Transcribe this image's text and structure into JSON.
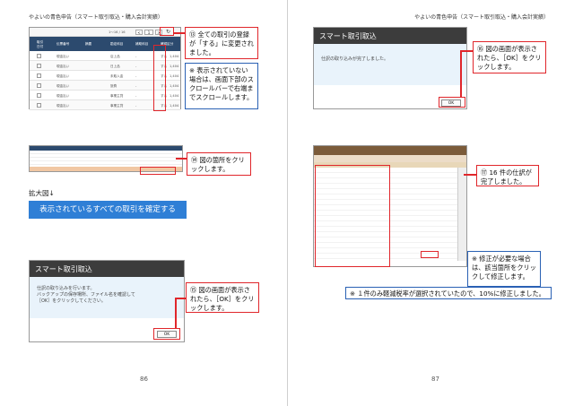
{
  "header": {
    "left": "やよいの青色申告（スマート取引取込・購入会計実績）",
    "right": "やよいの青色申告（スマート取引取込・購入会計実績）"
  },
  "page_numbers": {
    "left": "86",
    "right": "87"
  },
  "top_table": {
    "pager": "1～16 / 16",
    "page_input": "1",
    "headers": [
      "取引\n日付",
      "伝票番号",
      "摘要",
      "勘定科目",
      "補助科目",
      "確認区分"
    ],
    "rows": [
      [
        "現金払い",
        "店上品",
        "-",
        "する"
      ],
      [
        "現金払い",
        "日上品",
        "-",
        "する"
      ],
      [
        "現金払い",
        "未取入金",
        "-",
        "する"
      ],
      [
        "現金払い",
        "旅費",
        "-",
        "する"
      ],
      [
        "現金払い",
        "事業主貸",
        "-",
        "する"
      ],
      [
        "現金払い",
        "事業主貸",
        "-",
        "する"
      ]
    ],
    "amounts": [
      "1,404",
      "1,404",
      "1,404",
      "1,404",
      "1,404",
      "1,404"
    ]
  },
  "callout_13": "⑬ 全ての取引の登録が「する」に変更されました。",
  "callout_note_scroll": "※ 表示されていない場合は、画面下部のスクロールバーで右端までスクロールします。",
  "callout_14": "⑭ 図の箇所をクリックします。",
  "zoom_label": "拡大図↓",
  "confirm_button": "表示されているすべての取引を確定する",
  "dialog1": {
    "title": "スマート取引取込",
    "body_line1": "仕訳の取り込みを行います。",
    "body_line2": "バックアップの保存場所、ファイル名を確認して",
    "body_line3": "［OK］をクリックしてください。",
    "ok": "OK"
  },
  "callout_15": "⑮ 図の画面が表示されたら、［OK］をクリックします。",
  "dialog2": {
    "title": "スマート取引取込",
    "body": "仕訳の取り込みが完了しました。",
    "ok": "OK"
  },
  "callout_16": "⑯ 図の画面が表示されたら、［OK］をクリックします。",
  "callout_17": "⑰ 16 件の仕訳が完了しました。",
  "callout_note_fix": "※ 修正が必要な場合は、該当箇所をクリックして修正します。",
  "bottom_note": "※ １件のみ軽減税率が選択されていたので、10%に修正しました。",
  "colors": {
    "red": "#e0262b",
    "blue": "#2a61b4",
    "button_blue": "#2f7fd6",
    "dialog_bar": "#3c3c3c"
  }
}
